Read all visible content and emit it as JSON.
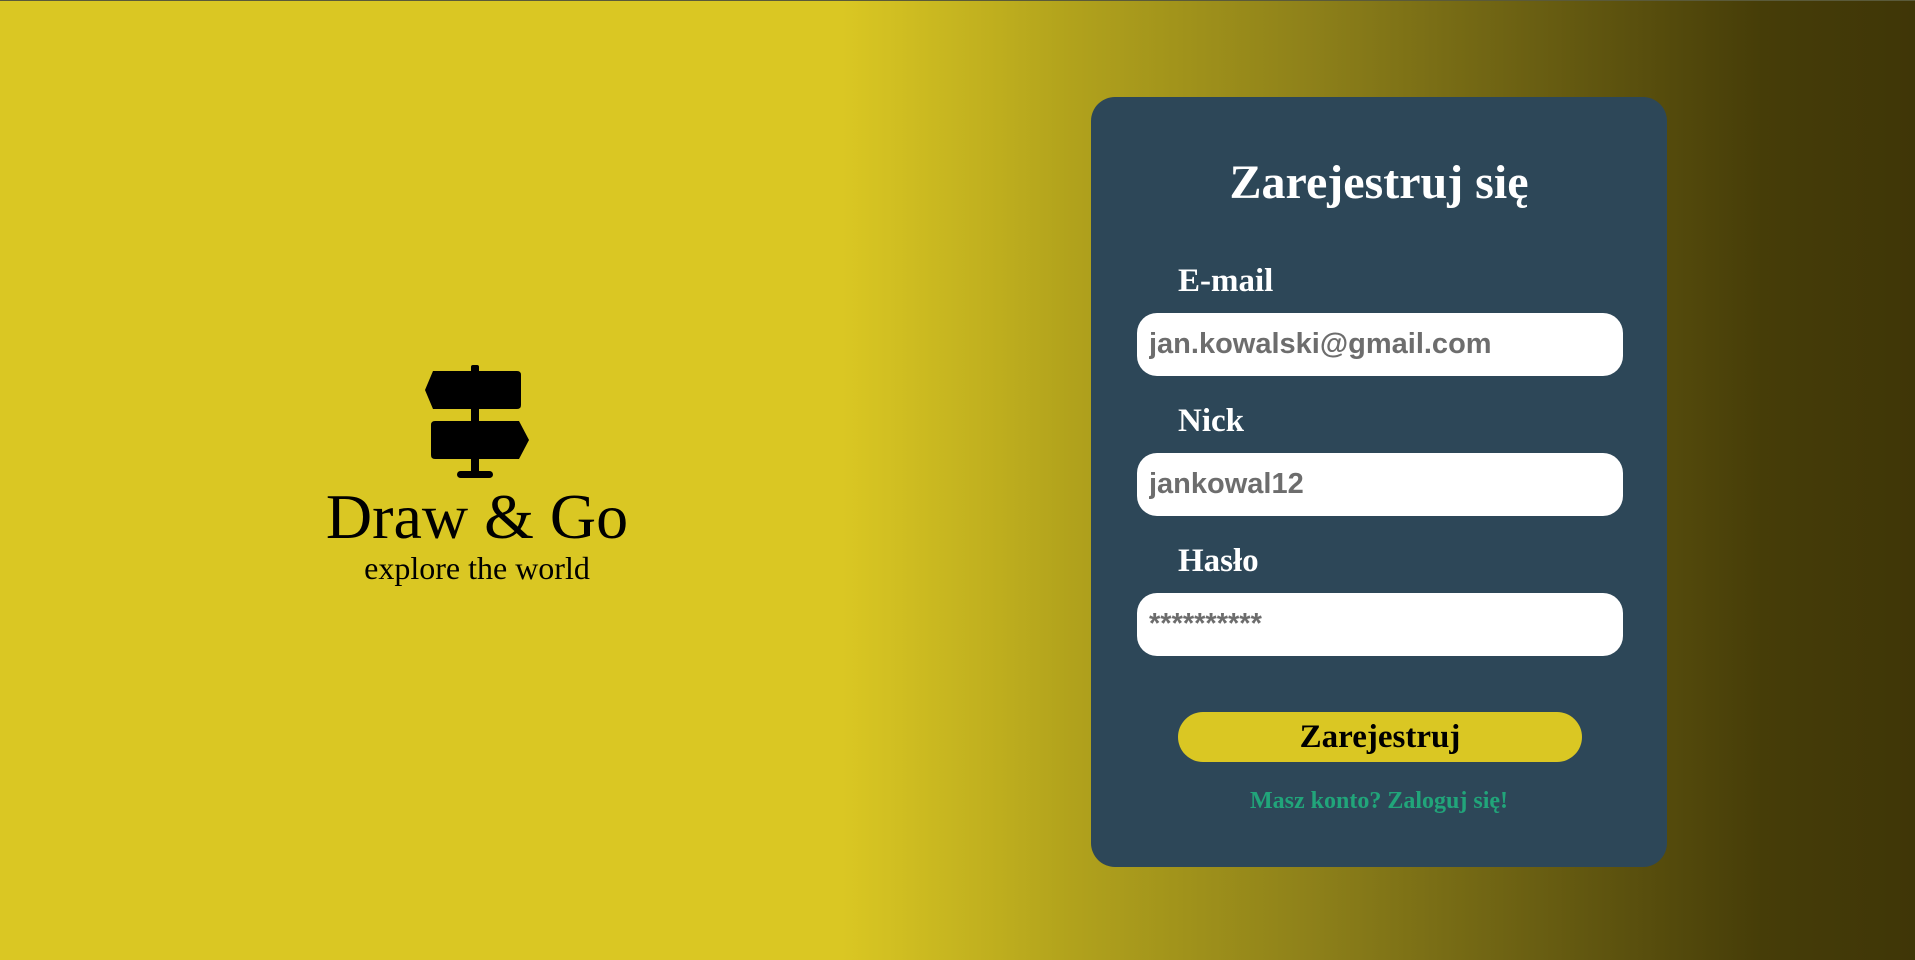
{
  "brand": {
    "logo_icon": "signpost-icon",
    "name": "Draw & Go",
    "tagline": "explore the world"
  },
  "register_form": {
    "title": "Zarejestruj się",
    "email": {
      "label": "E-mail",
      "placeholder": "jan.kowalski@gmail.com"
    },
    "nick": {
      "label": "Nick",
      "placeholder": "jankowal12"
    },
    "password": {
      "label": "Hasło",
      "placeholder": "**********"
    },
    "submit_label": "Zarejestruj",
    "login_link": "Masz konto? Zaloguj się!"
  },
  "colors": {
    "background_yellow": "#dac723",
    "background_dark": "#3f3607",
    "card": "#2d4758",
    "button": "#dac723",
    "link": "#21a57a"
  }
}
